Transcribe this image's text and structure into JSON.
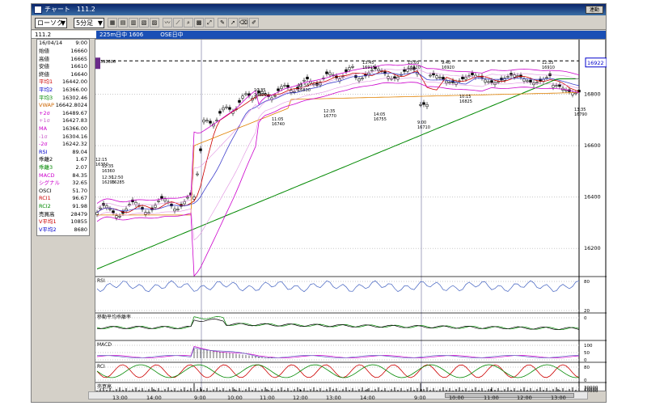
{
  "window": {
    "title": "チャート　111.2",
    "corner_button": "連動"
  },
  "toolbar": {
    "chart_type": "ローソク",
    "interval": "5分足",
    "arrow": "▼"
  },
  "codebar": {
    "code": "111.2",
    "header": "225m日中 1606　　　OSE日中"
  },
  "datapanel": {
    "date": "16/04/14",
    "time": "9:00",
    "rows": [
      {
        "label": "始値",
        "value": "16660",
        "color": "#000000"
      },
      {
        "label": "高値",
        "value": "16665",
        "color": "#000000"
      },
      {
        "label": "安値",
        "value": "16610",
        "color": "#000000"
      },
      {
        "label": "終値",
        "value": "16640",
        "color": "#000000"
      },
      {
        "label": "平均1",
        "value": "16442.00",
        "color": "#cc0000"
      },
      {
        "label": "平均2",
        "value": "16366.00",
        "color": "#0000cc"
      },
      {
        "label": "平均3",
        "value": "16302.46",
        "color": "#008800"
      },
      {
        "label": "VWAP",
        "value": "16642.8024",
        "color": "#cc6600"
      },
      {
        "label": "+2σ",
        "value": "16489.67",
        "color": "#cc00cc"
      },
      {
        "label": "+1σ",
        "value": "16427.83",
        "color": "#cc66cc"
      },
      {
        "label": "MA",
        "value": "16366.00",
        "color": "#cc00cc"
      },
      {
        "label": "-1σ",
        "value": "16304.16",
        "color": "#cc66cc"
      },
      {
        "label": "-2σ",
        "value": "16242.32",
        "color": "#cc00cc"
      },
      {
        "label": "RSI",
        "value": "89.04",
        "color": "#0000cc"
      },
      {
        "label": "乖離2",
        "value": "1.67",
        "color": "#000000"
      },
      {
        "label": "乖離3",
        "value": "2.07",
        "color": "#008800"
      },
      {
        "label": "MACD",
        "value": "84.35",
        "color": "#cc00cc"
      },
      {
        "label": "シグナル",
        "value": "32.65",
        "color": "#cc00cc"
      },
      {
        "label": "OSCI",
        "value": "51.70",
        "color": "#000000"
      },
      {
        "label": "RCI1",
        "value": "96.67",
        "color": "#cc0000"
      },
      {
        "label": "RCI2",
        "value": "91.98",
        "color": "#008800"
      },
      {
        "label": "売買高",
        "value": "28479",
        "color": "#000000"
      },
      {
        "label": "V平均1",
        "value": "10855",
        "color": "#cc0000"
      },
      {
        "label": "V平均2",
        "value": "8680",
        "color": "#0000cc"
      }
    ]
  },
  "chart": {
    "current_price_label": "16922",
    "dashed_label": "393606",
    "y_ticks": [
      "16800",
      "16600",
      "16400",
      "16200"
    ],
    "x_ticks": [
      "13:00",
      "14:00",
      "9:00",
      "10:00",
      "11:00",
      "12:00",
      "13:00",
      "14:00",
      "9:00",
      "10:00",
      "11:00",
      "12:00",
      "13:00"
    ],
    "annotations": [
      {
        "text": "12:35",
        "sub": "16360"
      },
      {
        "text": "12:15",
        "sub": "16350"
      },
      {
        "text": "12:30",
        "sub": "16295"
      },
      {
        "text": "12:50",
        "sub": "16285"
      },
      {
        "text": "10:35",
        "sub": "16805"
      },
      {
        "text": "11:05",
        "sub": "16740"
      },
      {
        "text": "11:55",
        "sub": "16830"
      },
      {
        "text": "12:35",
        "sub": "16770"
      },
      {
        "text": "13:45",
        "sub": "16915"
      },
      {
        "text": "14:05",
        "sub": "16755"
      },
      {
        "text": "15:05",
        "sub": "16920"
      },
      {
        "text": "9:00",
        "sub": "16710"
      },
      {
        "text": "9:40",
        "sub": "16920"
      },
      {
        "text": "10:15",
        "sub": "16825"
      },
      {
        "text": "12:35",
        "sub": "16910"
      },
      {
        "text": "13:35",
        "sub": "16790"
      }
    ]
  },
  "indicators": {
    "rsi": {
      "label": "RSI",
      "ticks": [
        "80",
        "20"
      ]
    },
    "kairi": {
      "label": "移動平均乖離率",
      "ticks": [
        "0"
      ]
    },
    "macd": {
      "label": "MACD",
      "ticks": [
        "100",
        "50",
        "0"
      ]
    },
    "rci": {
      "label": "RCI",
      "ticks": [
        "80",
        "0"
      ]
    },
    "volume": {
      "label": "売買高",
      "ticks": [
        "30000",
        "20000",
        "10000"
      ]
    }
  },
  "colors": {
    "candle_up": "#ffffff",
    "candle_down": "#000000",
    "bb_band": "#cc00cc",
    "ma1": "#cc0000",
    "ma2": "#4040cc",
    "ma3": "#008800",
    "vwap": "#e08000",
    "header_blue": "#1a4fb5"
  }
}
